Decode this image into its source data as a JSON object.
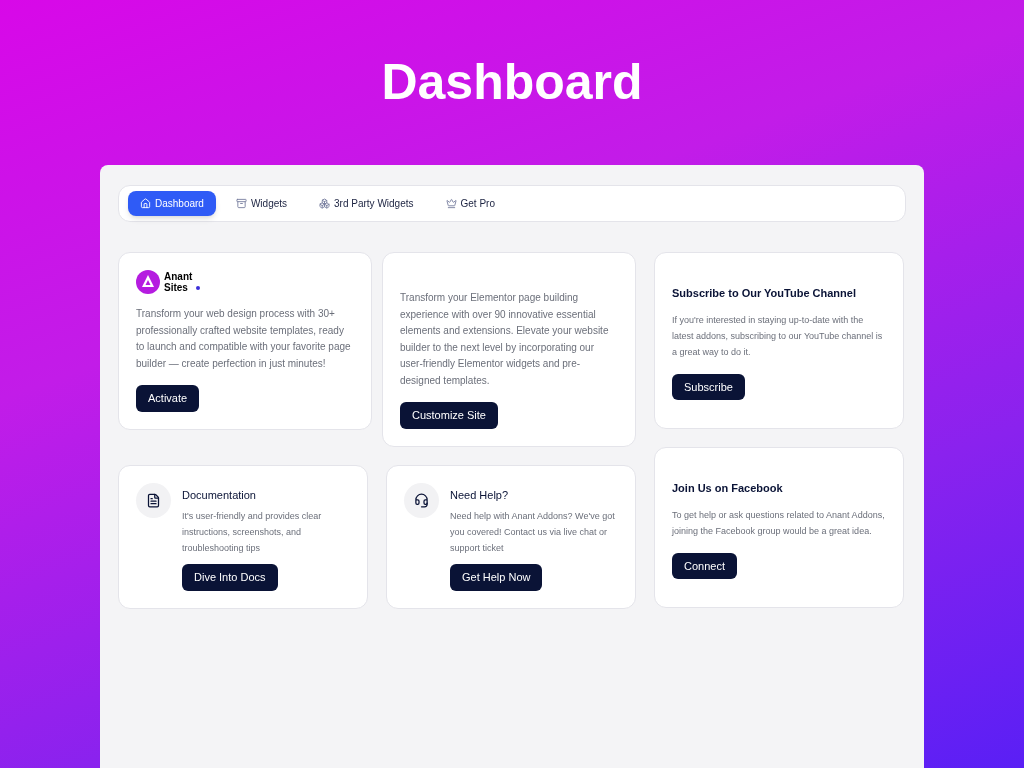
{
  "page_title": "Dashboard",
  "tabs": [
    {
      "label": "Dashboard",
      "selected": true
    },
    {
      "label": "Widgets",
      "selected": false
    },
    {
      "label": "3rd Party Widgets",
      "selected": false
    },
    {
      "label": "Get Pro",
      "selected": false
    }
  ],
  "promo_cards": [
    {
      "logo": [
        "Anant",
        "Sites"
      ],
      "text": "Transform your web design process with 30+ professionally crafted website templates, ready to launch and compatible with your favorite page builder — create perfection in just minutes!",
      "button": "Activate"
    },
    {
      "text": "Transform your Elementor page building experience with over 90 innovative essential elements and extensions. Elevate your website builder to the next level by incorporating our user-friendly Elementor widgets and pre-designed templates.",
      "button": "Customize Site"
    }
  ],
  "help_cards": [
    {
      "kind": "docs",
      "title": "Documentation",
      "text": "It's user-friendly and provides clear instructions, screenshots, and troubleshooting tips",
      "button": "Dive Into Docs"
    },
    {
      "kind": "support",
      "title": "Need Help?",
      "text": "Need help with Anant Addons? We've got you covered! Contact us via live chat or support ticket",
      "button": "Get Help Now"
    }
  ],
  "social_cards": [
    {
      "title": "Subscribe to Our YouTube Channel",
      "text": "If you're interested in staying up-to-date with the latest addons, subscribing to our YouTube channel is a great way to do it.",
      "button": "Subscribe"
    },
    {
      "title": "Join Us on Facebook",
      "text": "To get help or ask questions related to Anant Addons, joining the Facebook group would be a great idea.",
      "button": "Connect"
    }
  ]
}
